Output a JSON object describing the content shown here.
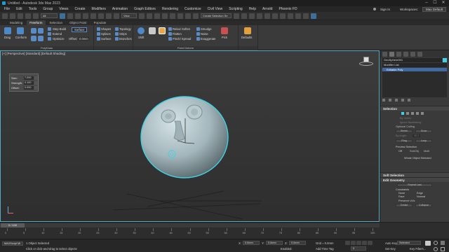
{
  "window": {
    "title": "Untitled - Autodesk 3ds Max 2023"
  },
  "menu": {
    "items": [
      "File",
      "Edit",
      "Tools",
      "Group",
      "Views",
      "Create",
      "Modifiers",
      "Animation",
      "Graph Editors",
      "Rendering",
      "Customize",
      "Civil View",
      "Scripting",
      "Help",
      "Arnold",
      "Phoenix FD"
    ],
    "workspaces_label": "Workspaces:",
    "workspace_value": "Max Default",
    "sign_in": "Sign In"
  },
  "toolbar": {
    "view_dropdown": "View",
    "selection_set_placeholder": "Create Selection Se"
  },
  "ribbon_tabs": [
    "Modeling",
    "Freeform",
    "Selection",
    "Object Paint",
    "Populate"
  ],
  "ribbon": {
    "panel1": {
      "drag_label": "Drag",
      "conform_label": "Conform",
      "step_build": "Step Build",
      "extend": "Extend",
      "optimize": "Optimize",
      "draw_on_value": "Surface",
      "offset_label": "Offset:",
      "offset_value": "0.0mm",
      "footer": "PolyDraw"
    },
    "panel2": {
      "shapes": "Shapes",
      "splines": "Splines",
      "surface": "Surface",
      "topology": "Topology",
      "strips": "Strips",
      "branches": "Branches"
    },
    "panel3": {
      "shift": "Shift",
      "relax_soften": "Relax/ Soften",
      "flatten": "Flatten",
      "pinch_spread": "Pinch/ Spread",
      "smudge": "Smudge",
      "noise": "Noise",
      "exaggerate": "Exaggerate",
      "pick": "Pick",
      "defaults": "Defaults",
      "footer": "Paint Deform"
    }
  },
  "viewport": {
    "label": "[+] [Perspective] [Standard] [Default Shading]",
    "paint_panel": {
      "rows": [
        {
          "label": "Size:",
          "value": "7.000"
        },
        {
          "label": "Strength:",
          "value": "0.100"
        },
        {
          "label": "Offset:",
          "value": "0.000"
        }
      ],
      "side_label": "Paint Deform"
    }
  },
  "command_panel": {
    "object_name": "GeoSphere001",
    "modifier_list_label": "Modifier List",
    "stack_item": "Editable Poly",
    "selection": {
      "heading": "Selection",
      "by_vertex": "By Vertex",
      "ignore_backfacing": "Ignore Backfacing",
      "by_angle_label": "By Angle:",
      "by_angle_value": "45.0",
      "optional_culling": "Optional Culling",
      "shrink": "Shrink",
      "grow": "Grow",
      "ring": "Ring",
      "loop": "Loop",
      "preview_selection": "Preview Selection",
      "preview_off": "Off",
      "preview_subobj": "SubObj",
      "preview_multi": "Multi",
      "status": "Whole Object Selected"
    },
    "soft_selection_heading": "Soft Selection",
    "edit_geometry": {
      "heading": "Edit Geometry",
      "repeat_last": "Repeat Last",
      "constraints_label": "Constraints",
      "none": "None",
      "edge": "Edge",
      "face": "Face",
      "normal": "Normal",
      "preserve_uvs": "Preserve UVs",
      "create": "Create",
      "collapse": "Collapse"
    }
  },
  "timeline": {
    "frame_display": "0 / 100",
    "tick_labels": [
      "0",
      "5",
      "10",
      "15",
      "20",
      "25",
      "30",
      "35",
      "40",
      "45",
      "50",
      "55",
      "60",
      "65",
      "70",
      "75",
      "80",
      "85",
      "90",
      "95",
      "100"
    ]
  },
  "statusbar": {
    "script_listener": "MAXScript Mi",
    "selected_text": "1 Object Selected",
    "prompt_text": "Click or click-and-drag to select objects",
    "x_label": "X:",
    "x_value": "0.0mm",
    "y_label": "Y:",
    "y_value": "0.0mm",
    "z_label": "Z:",
    "z_value": "0.0mm",
    "grid_label": "Grid = 0.0mm",
    "enabled_label": "Enabled:",
    "add_time_tag": "Add Time Tag",
    "auto_key": "Auto Key",
    "set_key": "Set Key",
    "selected_dropdown": "Selected",
    "key_filters": "Key Filters...",
    "frame_value": "0"
  }
}
